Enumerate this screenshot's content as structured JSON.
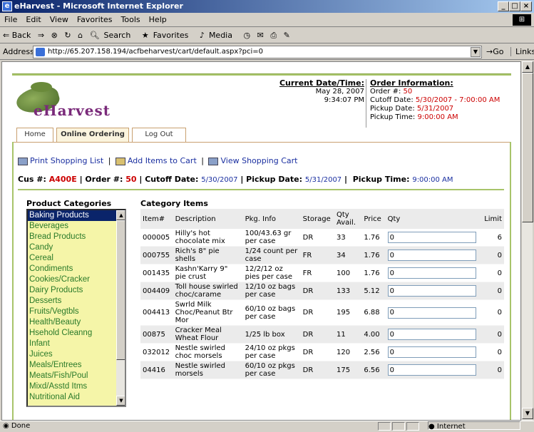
{
  "window": {
    "title": "eHarvest - Microsoft Internet Explorer"
  },
  "menu": [
    "File",
    "Edit",
    "View",
    "Favorites",
    "Tools",
    "Help"
  ],
  "toolbar": {
    "back": "⇐ Back",
    "forward": "⇒",
    "search": "Search",
    "favorites": "Favorites",
    "media": "Media"
  },
  "address": {
    "label": "Address",
    "url": "http://65.207.158.194/acfbeharvest/cart/default.aspx?pci=0",
    "go": "Go",
    "links": "Links"
  },
  "status": {
    "text": "Done",
    "zone": "Internet"
  },
  "logo": {
    "text": "eHarvest"
  },
  "datetime": {
    "heading": "Current Date/Time:",
    "date": "May 28, 2007",
    "time": "9:34:07 PM"
  },
  "order_info": {
    "heading": "Order Information:",
    "order_label": "Order #: ",
    "order_value": "50",
    "cutoff_label": "Cutoff Date: ",
    "cutoff_value": "5/30/2007 - 7:00:00 AM",
    "pickup_label": "Pickup Date: ",
    "pickup_value": "5/31/2007",
    "pickuptime_label": "Pickup Time: ",
    "pickuptime_value": "9:00:00 AM"
  },
  "tabs": [
    "Home",
    "Online Ordering",
    "Log Out"
  ],
  "actions": {
    "print": "Print Shopping List",
    "add": "Add Items to Cart",
    "view": "View Shopping Cart",
    "sep": "|"
  },
  "infoline": {
    "cus_label": "Cus #: ",
    "cus_value": "A400E",
    "order_label": "Order #: ",
    "order_value": "50",
    "cutoff_label": "Cutoff Date: ",
    "cutoff_value": "5/30/2007",
    "pickup_label": "Pickup Date: ",
    "pickup_value": "5/31/2007",
    "pickuptime_label": "Pickup Time: ",
    "pickuptime_value": "9:00:00 AM"
  },
  "categories": {
    "heading": "Product Categories",
    "items": [
      "Baking Products",
      "Beverages",
      "Bread Products",
      "Candy",
      "Cereal",
      "Condiments",
      "Cookies/Cracker",
      "Dairy Products",
      "Desserts",
      "Fruits/Vegtbls",
      "Health/Beauty",
      "Hsehold Cleanng",
      "Infant",
      "Juices",
      "Meals/Entrees",
      "Meats/Fish/Poul",
      "Mixd/Asstd Itms",
      "Nutritional Aid"
    ],
    "selected": "Baking Products"
  },
  "items": {
    "heading": "Category Items",
    "columns": [
      "Item#",
      "Description",
      "Pkg. Info",
      "Storage",
      "Qty Avail.",
      "Price",
      "Qty",
      "Limit"
    ],
    "rows": [
      {
        "item": "000005",
        "desc": "Hilly's hot chocolate mix",
        "pkg": "100/43.63 gr per case",
        "storage": "DR",
        "avail": "33",
        "price": "1.76",
        "qty": "0",
        "limit": "6"
      },
      {
        "item": "000755",
        "desc": "Rich's 8\" pie shells",
        "pkg": "1/24 count per case",
        "storage": "FR",
        "avail": "34",
        "price": "1.76",
        "qty": "0",
        "limit": "0"
      },
      {
        "item": "001435",
        "desc": "Kashn'Karry 9\" pie crust",
        "pkg": "12/2/12 oz pies per case",
        "storage": "FR",
        "avail": "100",
        "price": "1.76",
        "qty": "0",
        "limit": "0"
      },
      {
        "item": "004409",
        "desc": "Toll house swirled choc/carame",
        "pkg": "12/10 oz bags per case",
        "storage": "DR",
        "avail": "133",
        "price": "5.12",
        "qty": "0",
        "limit": "0"
      },
      {
        "item": "004413",
        "desc": "Swrld Milk Choc/Peanut Btr Mor",
        "pkg": "60/10 oz bags per case",
        "storage": "DR",
        "avail": "195",
        "price": "6.88",
        "qty": "0",
        "limit": "0"
      },
      {
        "item": "00875",
        "desc": "Cracker Meal Wheat Flour",
        "pkg": "1/25 lb box",
        "storage": "DR",
        "avail": "11",
        "price": "4.00",
        "qty": "0",
        "limit": "0"
      },
      {
        "item": "032012",
        "desc": "Nestle swirled choc morsels",
        "pkg": "24/10 oz pkgs per case",
        "storage": "DR",
        "avail": "120",
        "price": "2.56",
        "qty": "0",
        "limit": "0"
      },
      {
        "item": "04416",
        "desc": "Nestle swirled morsels",
        "pkg": "60/10 oz pkgs per case",
        "storage": "DR",
        "avail": "175",
        "price": "6.56",
        "qty": "0",
        "limit": "0"
      }
    ]
  },
  "colors": {
    "accent_green": "#a8c46a",
    "red_value": "#cc0000",
    "link_blue": "#1a2fa0",
    "list_bg": "#f5f5a8",
    "list_text": "#2a7a2a"
  }
}
